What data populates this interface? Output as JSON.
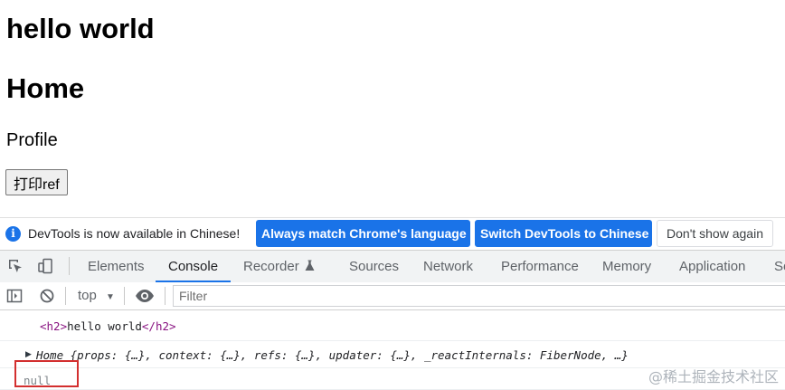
{
  "page": {
    "heading1": "hello world",
    "heading2": "Home",
    "profile_text": "Profile",
    "print_button": "打印ref"
  },
  "devtools": {
    "infobar": {
      "icon": "info-icon",
      "message": "DevTools is now available in Chinese!",
      "match_language_button": "Always match Chrome's language",
      "switch_language_button": "Switch DevTools to Chinese",
      "dont_show_button": "Don't show again"
    },
    "tabs": [
      {
        "label": "Elements",
        "active": false
      },
      {
        "label": "Console",
        "active": true
      },
      {
        "label": "Recorder",
        "active": false
      },
      {
        "label": "Sources",
        "active": false
      },
      {
        "label": "Network",
        "active": false
      },
      {
        "label": "Performance",
        "active": false
      },
      {
        "label": "Memory",
        "active": false
      },
      {
        "label": "Application",
        "active": false
      },
      {
        "label": "Se",
        "active": false
      }
    ],
    "toolbar": {
      "context": "top",
      "filter_placeholder": "Filter"
    },
    "console": {
      "line1": {
        "open_tag": "<h2>",
        "text": "hello world",
        "close_tag": "</h2>"
      },
      "line2": {
        "name": "Home",
        "props": "{props: {…}, context: {…}, refs: {…}, updater: {…}, _reactInternals: FiberNode, …}"
      },
      "line3": "null"
    }
  },
  "watermark": "@稀土掘金技术社区",
  "colors": {
    "accent": "#1a73e8",
    "highlight_box": "#d32f2f",
    "html_tag": "#881280"
  }
}
